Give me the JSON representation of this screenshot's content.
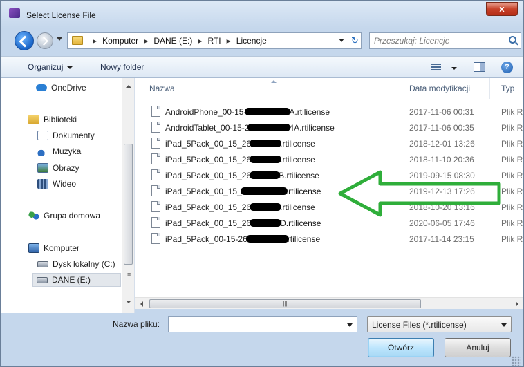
{
  "window": {
    "title": "Select License File",
    "close_glyph": "x"
  },
  "address": {
    "crumbs": [
      "Komputer",
      "DANE (E:)",
      "RTI",
      "Licencje"
    ],
    "refresh_glyph": "↻"
  },
  "search": {
    "placeholder": "Przeszukaj: Licencje"
  },
  "toolbar": {
    "organize": "Organizuj",
    "new_folder": "Nowy folder",
    "help_glyph": "?"
  },
  "nav": {
    "items": [
      {
        "label": "OneDrive",
        "icon": "cloud-icon"
      },
      {
        "label": "Biblioteki",
        "icon": "libraries-icon"
      },
      {
        "label": "Dokumenty",
        "icon": "documents-icon"
      },
      {
        "label": "Muzyka",
        "icon": "music-icon"
      },
      {
        "label": "Obrazy",
        "icon": "pictures-icon"
      },
      {
        "label": "Wideo",
        "icon": "video-icon"
      },
      {
        "label": "Grupa domowa",
        "icon": "homegroup-icon"
      },
      {
        "label": "Komputer",
        "icon": "computer-icon"
      },
      {
        "label": "Dysk lokalny (C:)",
        "icon": "local-disk-icon"
      },
      {
        "label": "DANE (E:)",
        "icon": "drive-icon",
        "selected": true
      }
    ]
  },
  "columns": {
    "name": "Nazwa",
    "date": "Data modyfikacji",
    "type": "Typ"
  },
  "files": [
    {
      "name_start": "AndroidPhone_00-15-",
      "name_end": "A.rtilicense",
      "date": "2017-11-06 00:31",
      "type": "Plik R"
    },
    {
      "name_start": "AndroidTablet_00-15-2",
      "name_end": "4A.rtilicense",
      "date": "2017-11-06 00:35",
      "type": "Plik R"
    },
    {
      "name_start": "iPad_5Pack_00_15_26",
      "name_end": ".rtilicense",
      "date": "2018-12-01 13:26",
      "type": "Plik R"
    },
    {
      "name_start": "iPad_5Pack_00_15_26",
      "name_end": ".rtilicense",
      "date": "2018-11-10 20:36",
      "type": "Plik R"
    },
    {
      "name_start": "iPad_5Pack_00_15_26",
      "name_end": "B.rtilicense",
      "date": "2019-09-15 08:30",
      "type": "Plik R"
    },
    {
      "name_start": "iPad_5Pack_00_15_",
      "name_end": ".rtilicense",
      "date": "2019-12-13 17:26",
      "type": "Plik R"
    },
    {
      "name_start": "iPad_5Pack_00_15_26",
      "name_end": ".rtilicense",
      "date": "2018-10-20 13:16",
      "type": "Plik R"
    },
    {
      "name_start": "iPad_5Pack_00_15_26",
      "name_end": "D.rtilicense",
      "date": "2020-06-05 17:46",
      "type": "Plik R"
    },
    {
      "name_start": "iPad_5Pack_00-15-26",
      "name_end": "rtilicense",
      "date": "2017-11-14 23:15",
      "type": "Plik R"
    }
  ],
  "bottom": {
    "file_name_label": "Nazwa pliku:",
    "file_name_value": "",
    "filter": "License Files (*.rtilicense)",
    "open_button": "Otwórz",
    "cancel_button": "Anuluj"
  },
  "colors": {
    "annotation_arrow": "#2fae3a",
    "accent": "#1763c7"
  }
}
